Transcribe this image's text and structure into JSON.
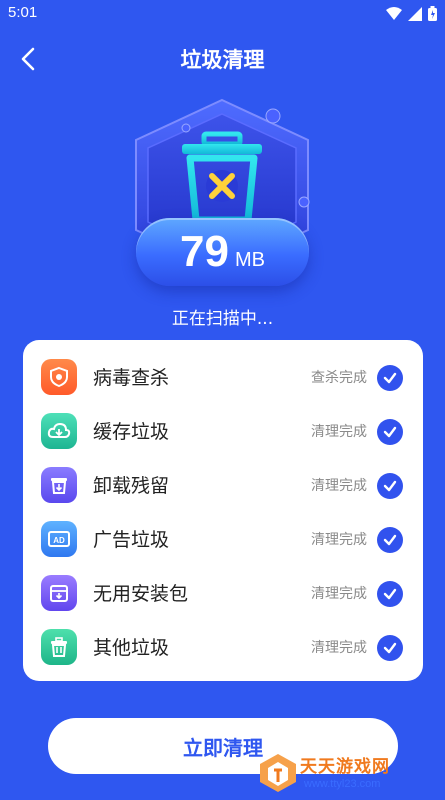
{
  "status_bar": {
    "time": "5:01"
  },
  "header": {
    "title": "垃圾清理"
  },
  "scan": {
    "size_value": "79",
    "size_unit": "MB",
    "status_text": "正在扫描中..."
  },
  "items": [
    {
      "label": "病毒查杀",
      "status": "查杀完成",
      "icon": "shield-virus-icon",
      "color": "#ff6a3a"
    },
    {
      "label": "缓存垃圾",
      "status": "清理完成",
      "icon": "cloud-cache-icon",
      "color": "#2ec6a4"
    },
    {
      "label": "卸载残留",
      "status": "清理完成",
      "icon": "uninstall-residue-icon",
      "color": "#6a5cf5"
    },
    {
      "label": "广告垃圾",
      "status": "清理完成",
      "icon": "ad-icon",
      "color": "#3f8ff7"
    },
    {
      "label": "无用安装包",
      "status": "清理完成",
      "icon": "package-icon",
      "color": "#7157f2"
    },
    {
      "label": "其他垃圾",
      "status": "清理完成",
      "icon": "trash-icon",
      "color": "#2ec69b"
    }
  ],
  "actions": {
    "clean_button": "立即清理"
  },
  "watermark": {
    "brand": "天天游戏网",
    "url": "www.ttyl23.com"
  }
}
